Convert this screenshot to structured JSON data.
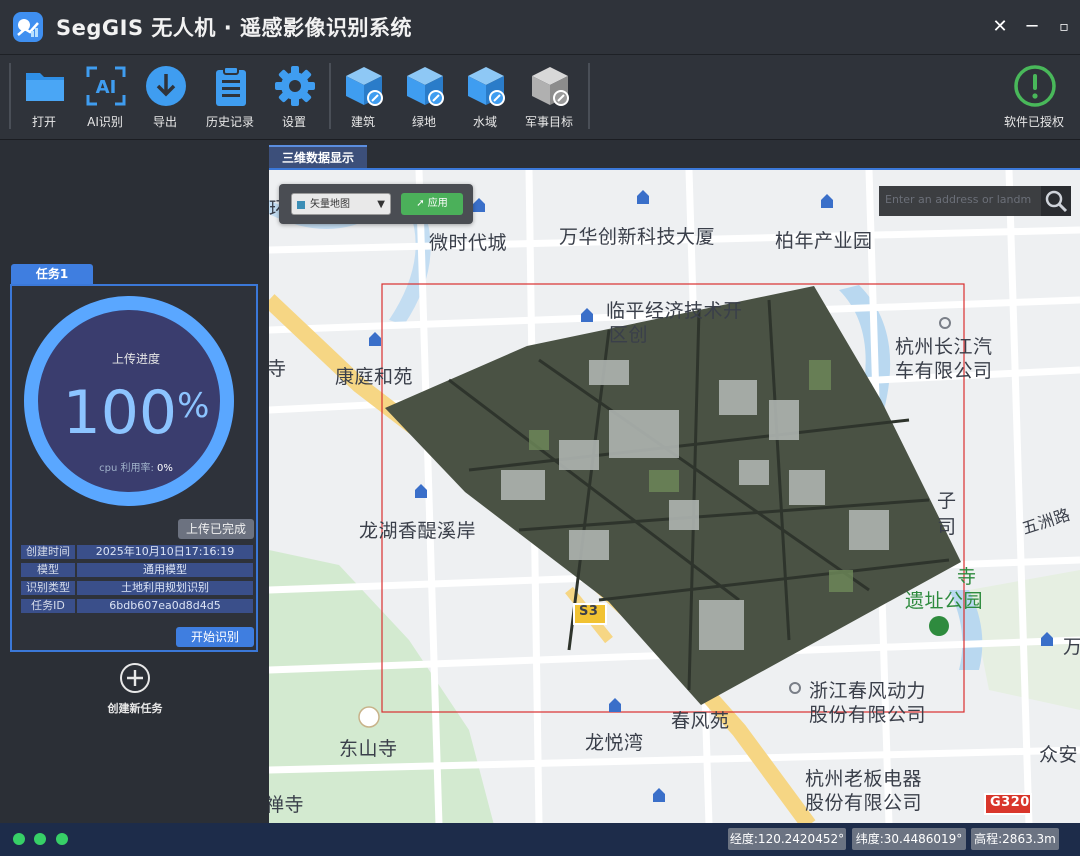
{
  "app": {
    "title": "SegGIS 无人机 · 遥感影像识别系统",
    "close_glyph": "✕",
    "min_glyph": "─",
    "max_glyph": "▫"
  },
  "toolbar": {
    "open": "打开",
    "ai_detect": "AI识别",
    "export": "导出",
    "history": "历史记录",
    "settings": "设置",
    "building": "建筑",
    "greenland": "绿地",
    "water": "水域",
    "military": "军事目标",
    "license": "软件已授权",
    "ai_glyph": "AI"
  },
  "task": {
    "tab": "任务1",
    "progress_label": "上传进度",
    "progress_value": "100",
    "progress_unit": "%",
    "progress_fraction": 1.0,
    "cpu_label": "cpu 利用率:",
    "cpu_value": "0%",
    "done_button": "上传已完成",
    "info": [
      {
        "key": "创建时间",
        "value": "2025年10月10日17:16:19"
      },
      {
        "key": "模型",
        "value": "通用模型"
      },
      {
        "key": "识别类型",
        "value": "土地利用规划识别"
      },
      {
        "key": "任务ID",
        "value": "6bdb607ea0d8d4d5"
      }
    ],
    "start_button": "开始识别",
    "new_task": "创建新任务"
  },
  "view": {
    "tab": "三维数据显示",
    "map_select": "矢量地图",
    "apply_button": "应用",
    "search_placeholder": "Enter an address or landm",
    "poi": [
      "微时代城",
      "万华创新科技大厦",
      "柏年产业园",
      "临平经济技术开",
      "区创",
      "杭州长江汽",
      "车有限公司",
      "康庭和苑",
      "寺",
      "龙湖香醍溪岸",
      "五洲路",
      "子",
      "司",
      "寺",
      "遗址公园",
      "S3",
      "浙江春风动力",
      "股份有限公司",
      "东山寺",
      "龙悦湾",
      "春风苑",
      "众安",
      "杭州老板电器",
      "股份有限公司",
      "禅寺",
      "G320",
      "万",
      "环"
    ]
  },
  "status": {
    "longitude": "经度:120.2420452°",
    "latitude": "纬度:30.4486019°",
    "altitude": "高程:2863.3m"
  },
  "colors": {
    "accent": "#3f7ee0",
    "progress_ring": "#5aa7ff",
    "status_green": "#37d067",
    "license_green": "#49b85a",
    "selection_box": "#d93030"
  }
}
